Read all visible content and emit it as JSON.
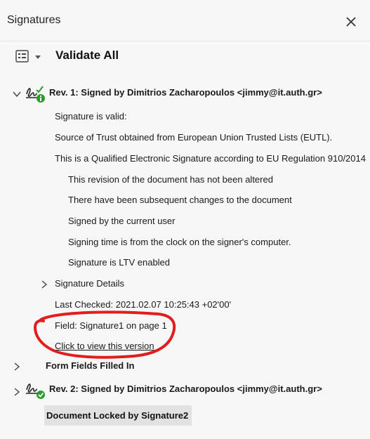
{
  "header": {
    "title": "Signatures",
    "close_icon": "close-icon"
  },
  "toolbar": {
    "options_icon": "list-options-icon",
    "validate_all_label": "Validate All"
  },
  "revisions": [
    {
      "title": "Rev. 1: Signed by Dimitrios Zacharopoulos <jimmy@it.auth.gr>",
      "expanded": true,
      "details": {
        "status": "Signature is valid:",
        "trust_source": "Source of Trust obtained from European Union Trusted Lists (EUTL).",
        "qualified": "This is a Qualified Electronic Signature according to EU Regulation 910/2014",
        "checks": [
          "This revision of the document has not been altered",
          "There have been subsequent changes to the document",
          "Signed by the current user",
          "Signing time is from the clock on the signer's computer.",
          "Signature is LTV enabled"
        ],
        "signature_details_label": "Signature Details",
        "last_checked": "Last Checked: 2021.02.07 10:25:43 +02'00'",
        "field": "Field: Signature1 on page 1",
        "view_version_link": "Click to view this version"
      }
    },
    {
      "title": "Rev. 2: Signed by Dimitrios Zacharopoulos <jimmy@it.auth.gr>",
      "expanded": false
    }
  ],
  "form_fields_label": "Form Fields Filled In",
  "document_locked_label": "Document Locked by Signature2",
  "colors": {
    "panel_background": "#f7f7f7",
    "valid_green": "#2d9a2d",
    "annotation_red": "#e11d1d",
    "locked_background": "#e2e2e2"
  }
}
